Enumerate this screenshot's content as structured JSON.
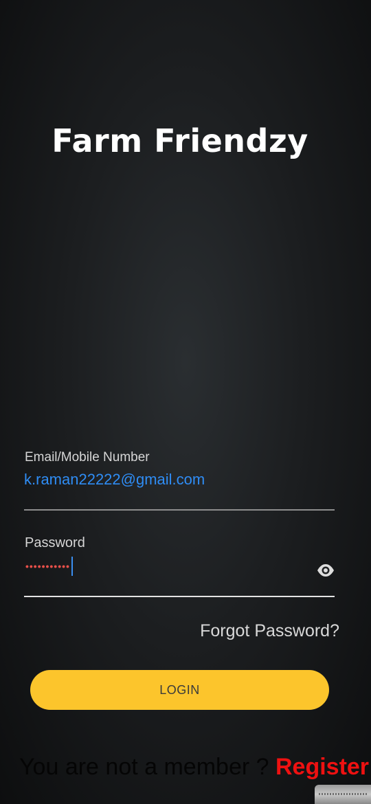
{
  "app": {
    "title": "Farm Friendzy"
  },
  "login_form": {
    "email_label": "Email/Mobile Number",
    "email_value": "k.raman22222@gmail.com",
    "password_label": "Password",
    "password_mask": "•••••••••••",
    "password_toggle_icon": "eye-icon",
    "forgot_password_label": "Forgot Password?",
    "login_button_label": "LOGIN"
  },
  "footer": {
    "member_text": "You are not a member ? ",
    "register_label": "Register"
  },
  "colors": {
    "accent_yellow": "#fcc52c",
    "register_red": "#ee1111",
    "email_blue": "#2f8df5",
    "password_dot_red": "#e8504a"
  }
}
